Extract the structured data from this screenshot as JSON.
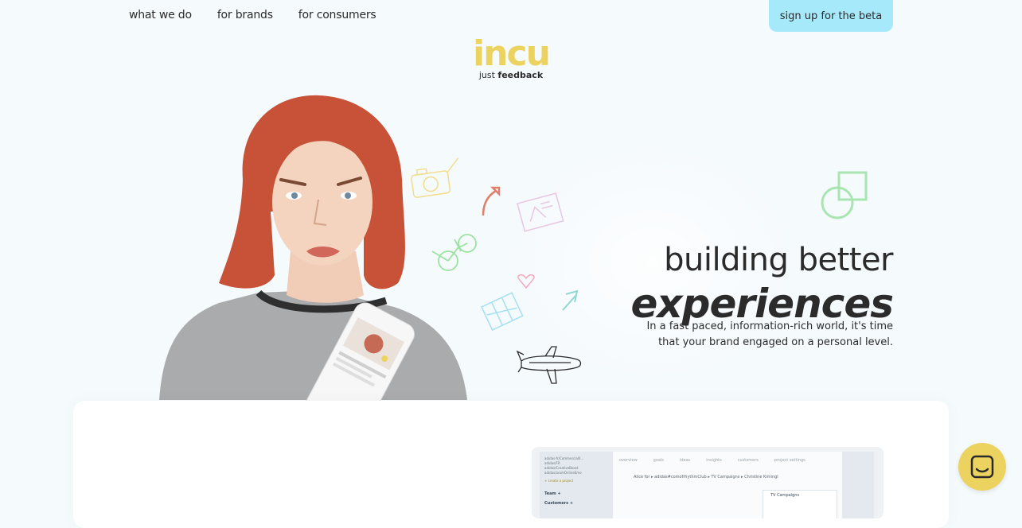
{
  "nav": {
    "items": [
      {
        "label": "what we do"
      },
      {
        "label": "for brands"
      },
      {
        "label": "for consumers"
      }
    ],
    "cta_label": "sign up for the beta"
  },
  "logo": {
    "word": "incu",
    "tagline_prefix": "just",
    "tagline_bold": "feedback"
  },
  "hero": {
    "headline_line1": "building better",
    "headline_line2": "experiences",
    "subcopy": "In a fast paced, information-rich world, it's time that your brand engaged on a personal level.",
    "accent_color": "#a9e5b0",
    "brand_yellow": "#ecd35f",
    "cta_color": "#a6e9fb"
  },
  "preview": {
    "tabs": [
      "overview",
      "goals",
      "ideas",
      "insights",
      "customers",
      "project settings"
    ],
    "breadcrumb": "Alice for  ▸  adidas#comofrhythmClub  ▸  TV Campaigns  ▸  Christine Kimingl",
    "side_items": [
      "adidas-fr/Commercial/I...",
      "adidas/FR",
      "adidas/CreativeBoost",
      "adidas/aromOnlineEmo"
    ],
    "side_link": "+ create a project",
    "team_label": "Team +",
    "customers_label": "Customers +",
    "card_title": "TV Campaigns"
  },
  "chat": {
    "icon": "chat-icon"
  }
}
